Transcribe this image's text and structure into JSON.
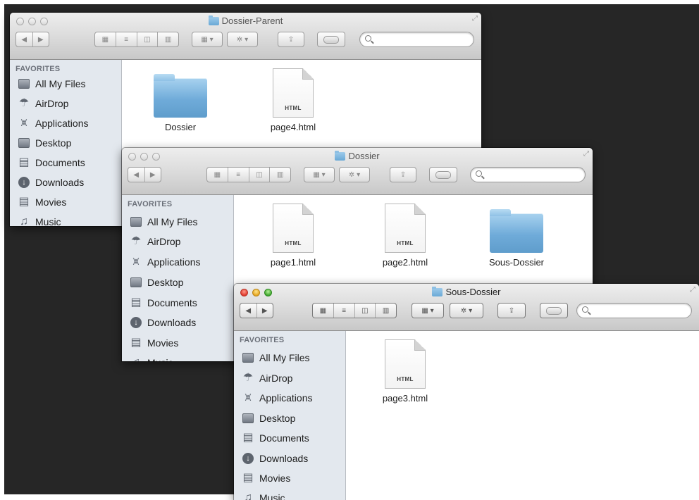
{
  "sidebar_common": {
    "heading": "FAVORITES",
    "items": [
      {
        "label": "All My Files"
      },
      {
        "label": "AirDrop"
      },
      {
        "label": "Applications"
      },
      {
        "label": "Desktop"
      },
      {
        "label": "Documents"
      },
      {
        "label": "Downloads"
      },
      {
        "label": "Movies"
      },
      {
        "label": "Music"
      }
    ]
  },
  "windows": [
    {
      "title": "Dossier-Parent",
      "active": false,
      "files": [
        {
          "name": "Dossier",
          "kind": "folder"
        },
        {
          "name": "page4.html",
          "kind": "document",
          "ext": "HTML"
        }
      ]
    },
    {
      "title": "Dossier",
      "active": false,
      "files": [
        {
          "name": "page1.html",
          "kind": "document",
          "ext": "HTML"
        },
        {
          "name": "page2.html",
          "kind": "document",
          "ext": "HTML"
        },
        {
          "name": "Sous-Dossier",
          "kind": "folder"
        }
      ]
    },
    {
      "title": "Sous-Dossier",
      "active": true,
      "files": [
        {
          "name": "page3.html",
          "kind": "document",
          "ext": "HTML"
        }
      ]
    }
  ],
  "toolbar": {
    "back_glyph": "◀",
    "forward_glyph": "▶",
    "arrange_glyph": "▾",
    "action_glyph": "✲ ▾",
    "share_glyph": "⇪",
    "view_icon_glyph": "▦",
    "view_list_glyph": "≡",
    "view_column_glyph": "◫",
    "view_coverflow_glyph": "▥",
    "search_placeholder": ""
  },
  "colors": {
    "desktop": "#262626",
    "sidebar": "#e3e8ee",
    "folder": "#6fabd9",
    "close": "#e0392b",
    "minimize": "#e6a51f",
    "zoom": "#3ea52c"
  }
}
